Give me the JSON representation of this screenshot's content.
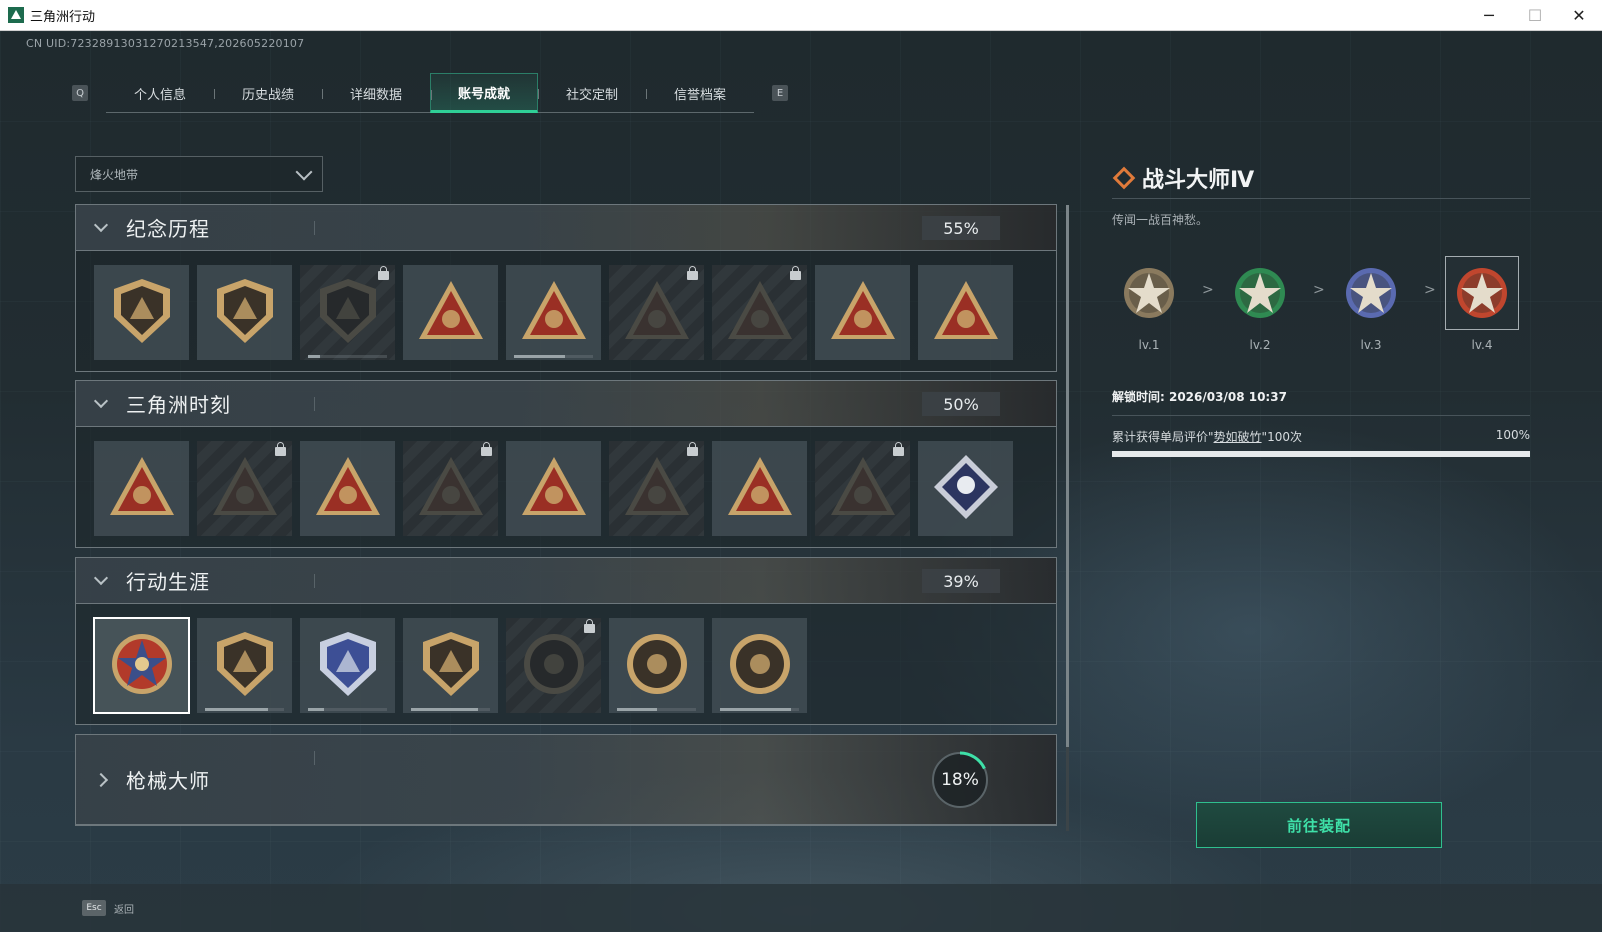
{
  "window": {
    "title": "三角洲行动"
  },
  "uid_text": "CN UID:7232891303127021​3547,202605220107",
  "tabs": {
    "left_key": "Q",
    "right_key": "E",
    "items": [
      {
        "label": "个人信息",
        "active": false
      },
      {
        "label": "历史战绩",
        "active": false
      },
      {
        "label": "详细数据",
        "active": false
      },
      {
        "label": "账号成就",
        "active": true
      },
      {
        "label": "社交定制",
        "active": false
      },
      {
        "label": "信誉档案",
        "active": false
      }
    ]
  },
  "mode_select": {
    "value": "烽火地带"
  },
  "sections": [
    {
      "name": "纪念历程",
      "percent": "55%",
      "expanded": true,
      "badges": [
        {
          "icon": "delta-emblem-icon",
          "locked": false,
          "progress": 0
        },
        {
          "icon": "helicopter-badge-icon",
          "locked": false,
          "progress": 0
        },
        {
          "icon": "dark-shield-icon",
          "locked": true,
          "progress": 0.15
        },
        {
          "icon": "s8-badge-icon",
          "locked": false,
          "progress": 0
        },
        {
          "icon": "s9-winged-badge-icon",
          "locked": false,
          "progress": 0.65
        },
        {
          "icon": "hooded-operator-icon",
          "locked": true,
          "progress": 0
        },
        {
          "icon": "skull-wings-icon",
          "locked": true,
          "progress": 0
        },
        {
          "icon": "wave-triangle-icon",
          "locked": false,
          "progress": 0
        },
        {
          "icon": "number-one-triangle-icon",
          "locked": false,
          "progress": 0
        }
      ]
    },
    {
      "name": "三角洲时刻",
      "percent": "50%",
      "expanded": true,
      "badges": [
        {
          "icon": "device-triangle-icon",
          "locked": false,
          "progress": 0
        },
        {
          "icon": "armored-triangle-icon",
          "locked": true,
          "progress": 0
        },
        {
          "icon": "kneeling-soldier-icon",
          "locked": false,
          "progress": 0
        },
        {
          "icon": "hands-triangle-icon",
          "locked": true,
          "progress": 0
        },
        {
          "icon": "squad-triangle-icon",
          "locked": false,
          "progress": 0
        },
        {
          "icon": "beast-triangle-icon",
          "locked": true,
          "progress": 0
        },
        {
          "icon": "rocket-triangle-icon",
          "locked": false,
          "progress": 0
        },
        {
          "icon": "serpent-triangle-icon",
          "locked": true,
          "progress": 0
        },
        {
          "icon": "rose-diamond-icon",
          "locked": false,
          "progress": 0
        }
      ]
    },
    {
      "name": "行动生涯",
      "percent": "39%",
      "expanded": true,
      "badges": [
        {
          "icon": "star-medal-icon",
          "locked": false,
          "selected": true,
          "progress": 0
        },
        {
          "icon": "chevron-shield-icon",
          "locked": false,
          "progress": 0.8
        },
        {
          "icon": "blue-police-shield-icon",
          "locked": false,
          "progress": 0.2
        },
        {
          "icon": "crystal-shield-icon",
          "locked": false,
          "progress": 0.85
        },
        {
          "icon": "dark-circle-medal-icon",
          "locked": true,
          "progress": 0
        },
        {
          "icon": "crosshair-operator-icon",
          "locked": false,
          "progress": 0.5
        },
        {
          "icon": "eye-circle-icon",
          "locked": false,
          "progress": 0.9
        }
      ]
    },
    {
      "name": "枪械大师",
      "percent": "18%",
      "expanded": false,
      "ring_fraction": 0.18
    }
  ],
  "detail": {
    "title": "战斗大师Ⅳ",
    "description": "传闻一战百神愁。",
    "levels": [
      {
        "label": "lv.1",
        "color": "#8a7a5e"
      },
      {
        "label": "lv.2",
        "color": "#2f8a52"
      },
      {
        "label": "lv.3",
        "color": "#5a6ab0"
      },
      {
        "label": "lv.4",
        "color": "#c0462e"
      }
    ],
    "separator": ">",
    "unlock_time": "解锁时间: 2026/03/08 10:37",
    "requirement_prefix": "累计获得单局评价\"",
    "requirement_link": "势如破竹",
    "requirement_suffix": "\"100次",
    "requirement_percent": "100%",
    "requirement_progress": 1.0,
    "equip_button": "前往装配"
  },
  "bottom": {
    "esc_key": "Esc",
    "back_label": "返回"
  }
}
